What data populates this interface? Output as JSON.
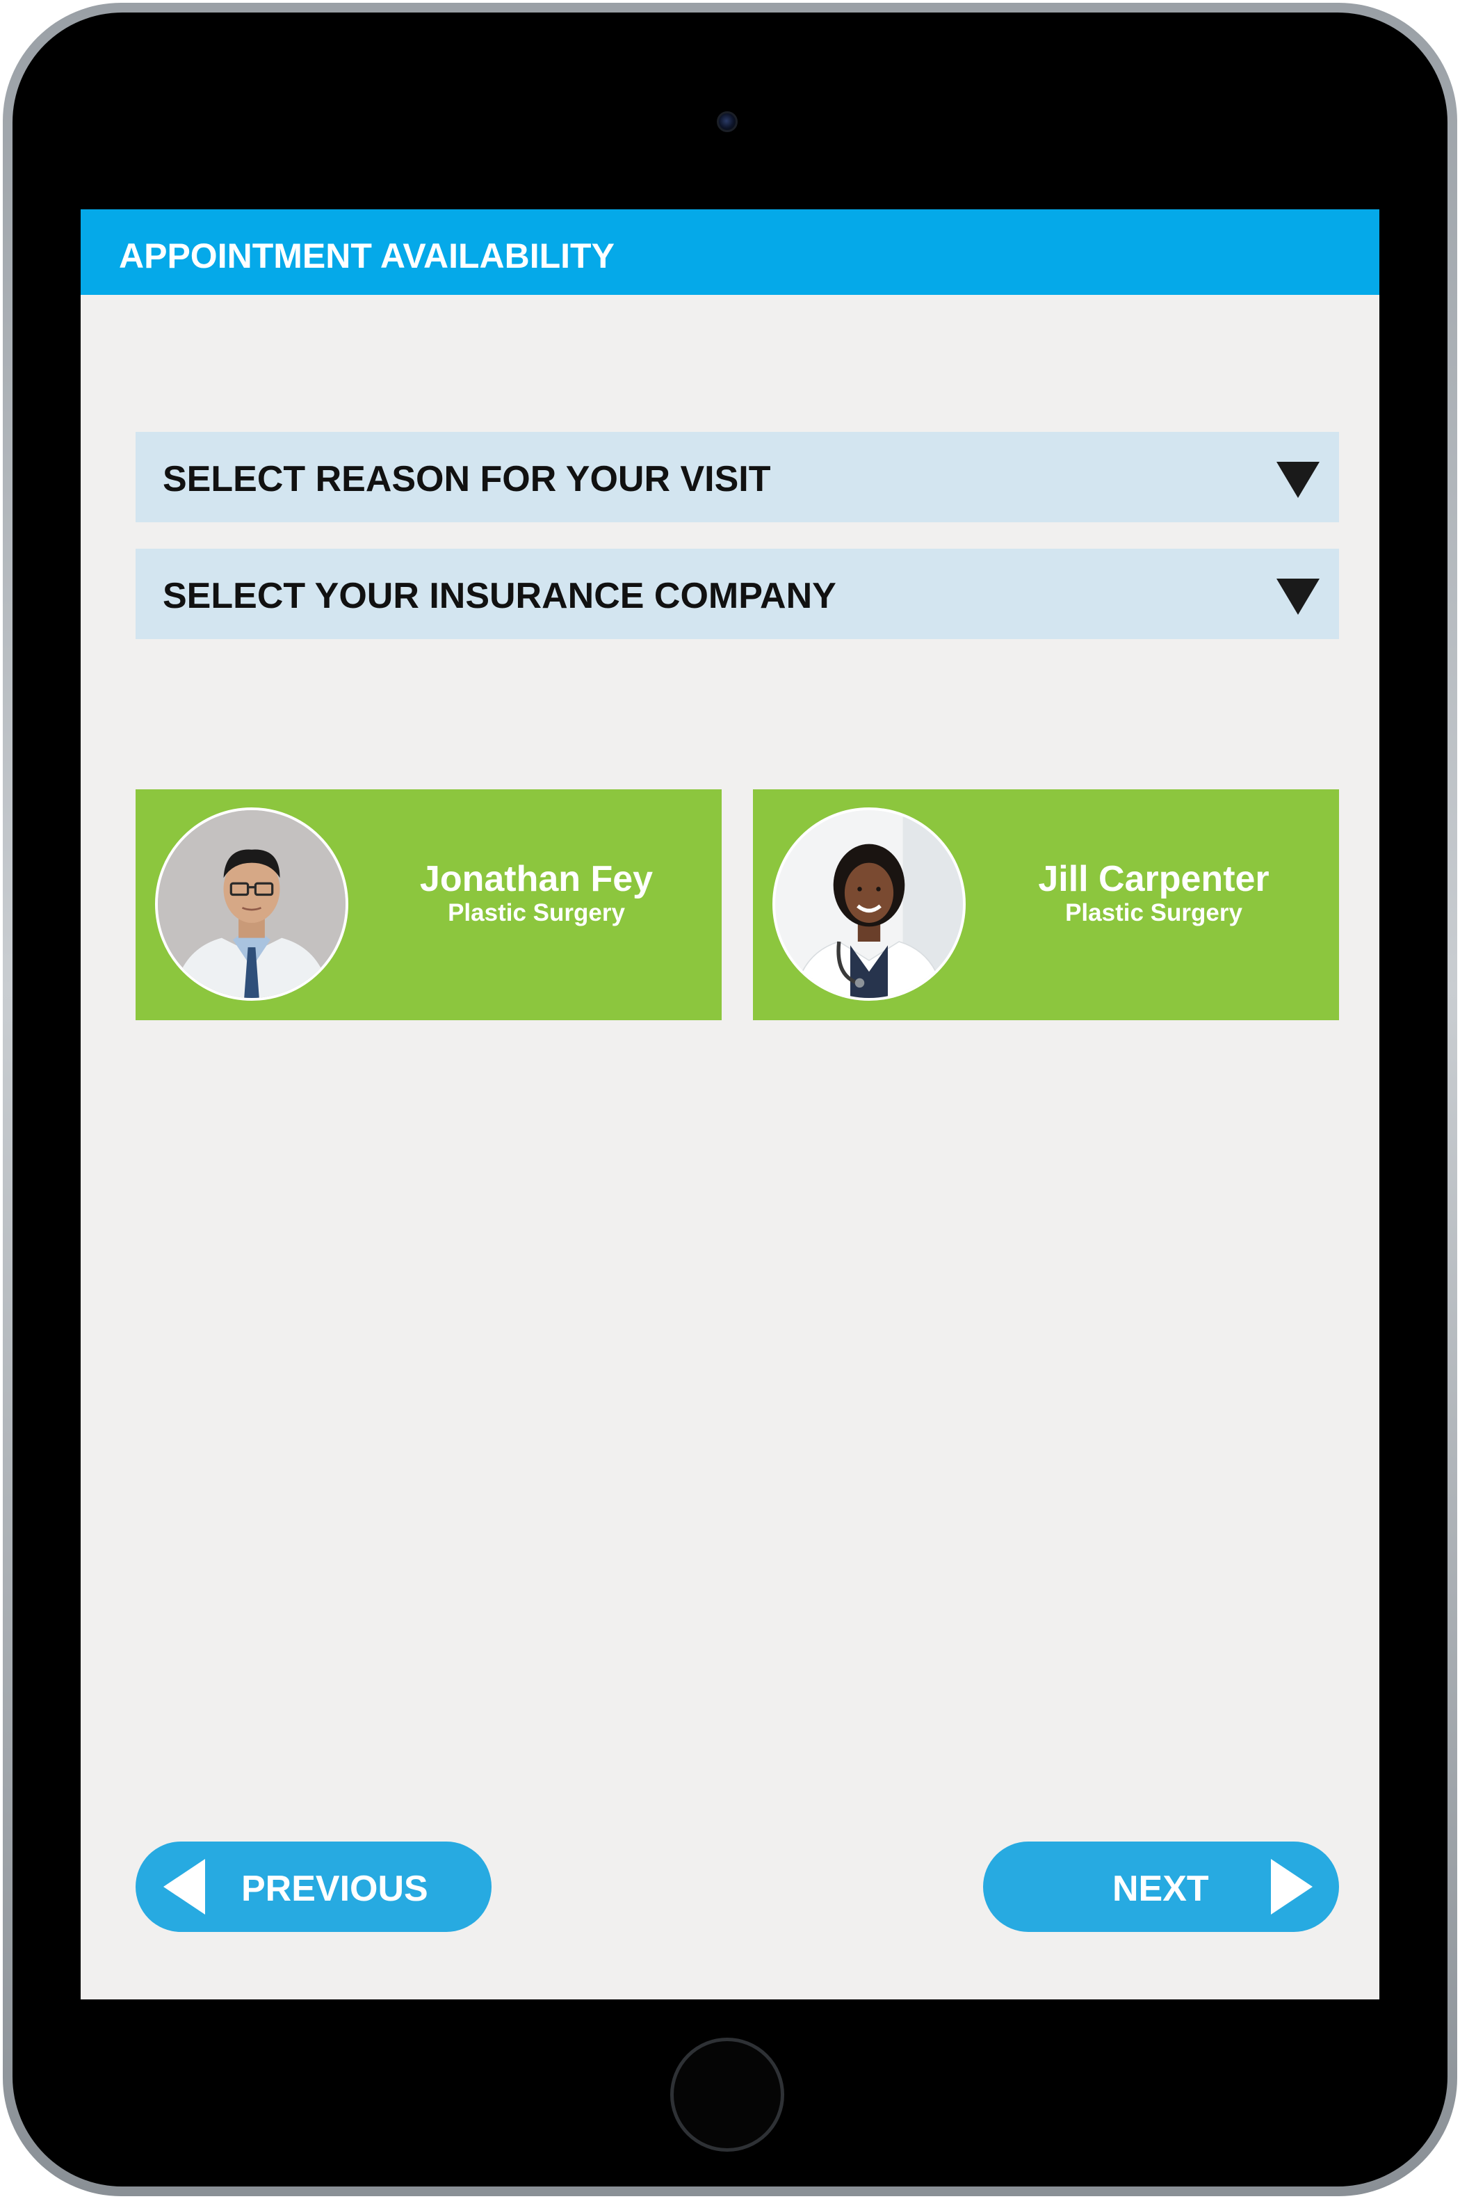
{
  "header": {
    "title": "APPOINTMENT AVAILABILITY",
    "color": "#05a9e9"
  },
  "selects": [
    {
      "label": "SELECT REASON FOR YOUR VISIT",
      "icon": "caret-down-icon"
    },
    {
      "label": "SELECT YOUR INSURANCE COMPANY",
      "icon": "caret-down-icon"
    }
  ],
  "doctors": [
    {
      "name": "Jonathan Fey",
      "specialty": "Plastic Surgery",
      "avatar": "doctor-photo"
    },
    {
      "name": "Jill Carpenter",
      "specialty": "Plastic Surgery",
      "avatar": "doctor-photo"
    }
  ],
  "navigation": {
    "previous_label": "PREVIOUS",
    "next_label": "NEXT",
    "previous_icon": "arrow-left-icon",
    "next_icon": "arrow-right-icon"
  },
  "colors": {
    "screen_background": "#f1f0ef",
    "select_background": "#d3e5f0",
    "card_green": "#8cc63e",
    "button_blue": "#27aae1"
  }
}
